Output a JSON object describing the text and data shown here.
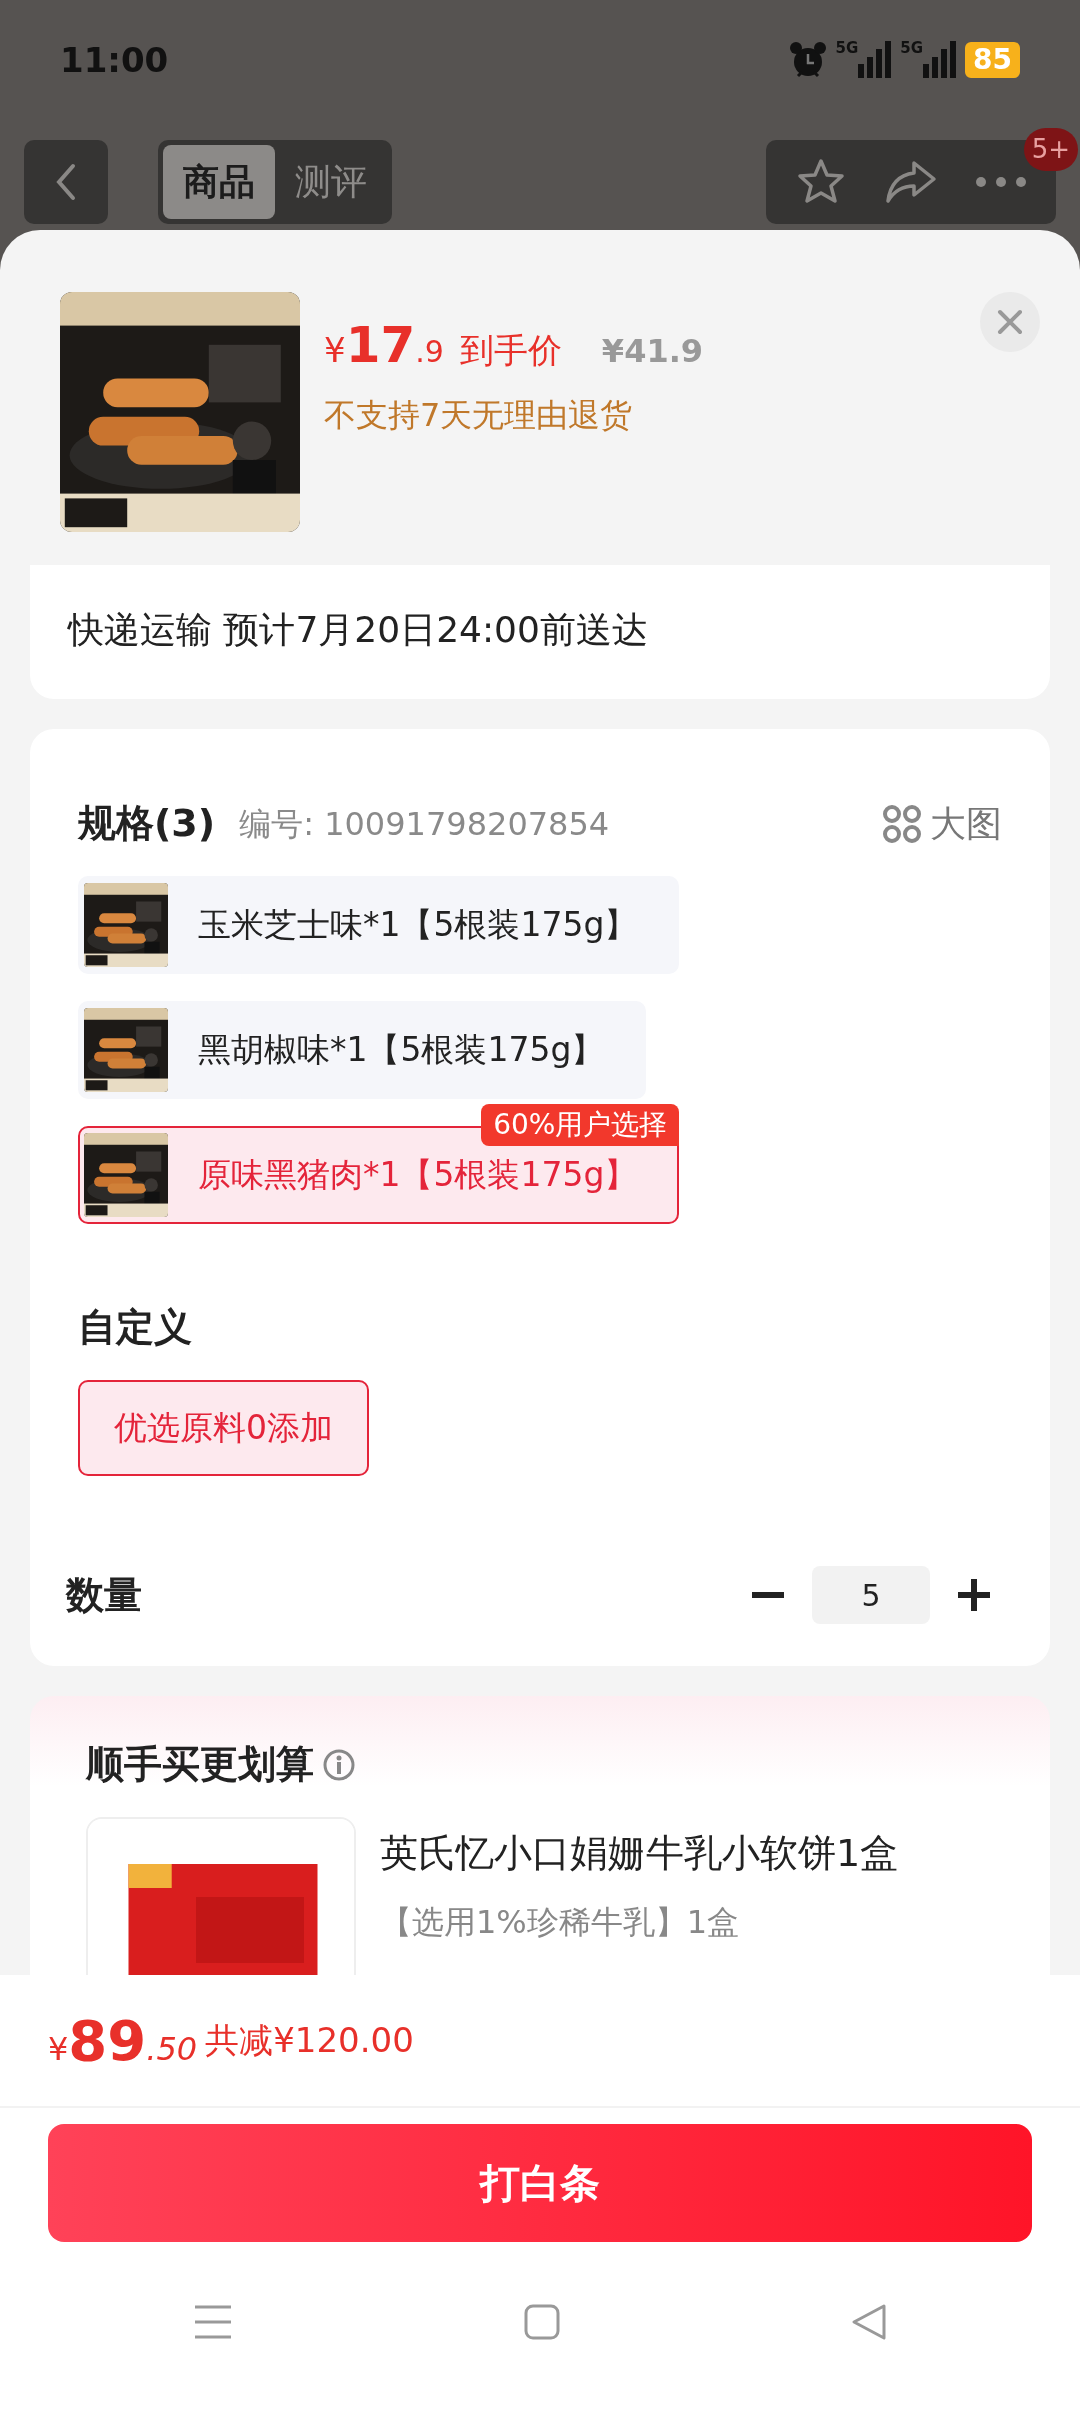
{
  "status_bar": {
    "time": "11:00",
    "networks": [
      "5G",
      "5G"
    ],
    "battery": "85"
  },
  "top_nav": {
    "tabs": [
      {
        "label": "商品",
        "selected": true
      },
      {
        "label": "测评",
        "selected": false
      }
    ],
    "badge": "5+"
  },
  "product": {
    "price": {
      "symbol": "¥",
      "integer": "17",
      "decimal": ".9"
    },
    "price_label": "到手价",
    "original_price": "¥41.9",
    "return_note": "不支持7天无理由退货"
  },
  "delivery": "快递运输 预计7月20日24:00前送达",
  "spec": {
    "title": "规格(3)",
    "sku": "编号: 10091798207854",
    "view_large": "大图",
    "options": [
      {
        "label": "玉米芝士味*1【5根装175g】",
        "selected": false
      },
      {
        "label": "黑胡椒味*1【5根装175g】",
        "selected": false
      },
      {
        "label": "原味黑猪肉*1【5根装175g】",
        "selected": true,
        "tag": "60%用户选择"
      }
    ]
  },
  "custom": {
    "title": "自定义",
    "options": [
      {
        "label": "优选原料0添加",
        "selected": true
      }
    ]
  },
  "quantity": {
    "label": "数量",
    "value": "5"
  },
  "bundle": {
    "title": "顺手买更划算",
    "item": {
      "name": "英氏忆小口娟姗牛乳小软饼1盒",
      "desc": "【选用1%珍稀牛乳】1盒"
    }
  },
  "footer": {
    "price": {
      "symbol": "¥",
      "integer": "89",
      "decimal": ".50"
    },
    "discount": "共减¥120.00",
    "button": "打白条"
  }
}
